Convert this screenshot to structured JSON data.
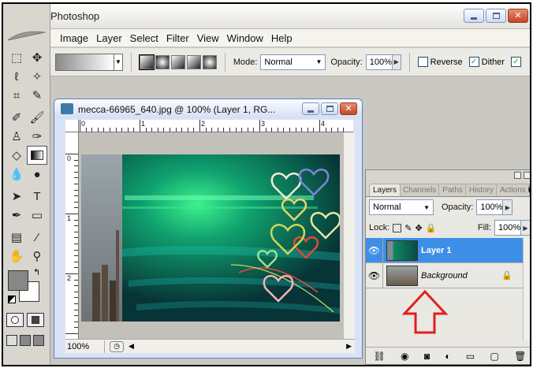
{
  "app": {
    "title": "Photoshop",
    "menu": [
      "Image",
      "Layer",
      "Select",
      "Filter",
      "View",
      "Window",
      "Help"
    ]
  },
  "options": {
    "mode_label": "Mode:",
    "mode_value": "Normal",
    "opacity_label": "Opacity:",
    "opacity_value": "100%",
    "reverse_label": "Reverse",
    "dither_label": "Dither",
    "reverse_checked": false,
    "dither_checked": true
  },
  "document": {
    "title": "mecca-66965_640.jpg @ 100% (Layer 1, RG...",
    "zoom": "100%",
    "ruler_h": [
      "0",
      "1",
      "2",
      "3",
      "4"
    ],
    "ruler_v": [
      "0",
      "1",
      "2"
    ]
  },
  "layers_panel": {
    "tabs": [
      "Layers",
      "Channels",
      "Paths",
      "History",
      "Actions"
    ],
    "blend_mode": "Normal",
    "opacity_label": "Opacity:",
    "opacity_value": "100%",
    "lock_label": "Lock:",
    "fill_label": "Fill:",
    "fill_value": "100%",
    "layers": [
      {
        "name": "Layer 1",
        "selected": true
      },
      {
        "name": "Background",
        "selected": false
      }
    ]
  },
  "colors": {
    "selection": "#3d8ee7",
    "annotation_arrow": "#e31e1e",
    "foreground": "#878787",
    "background": "#ffffff"
  }
}
